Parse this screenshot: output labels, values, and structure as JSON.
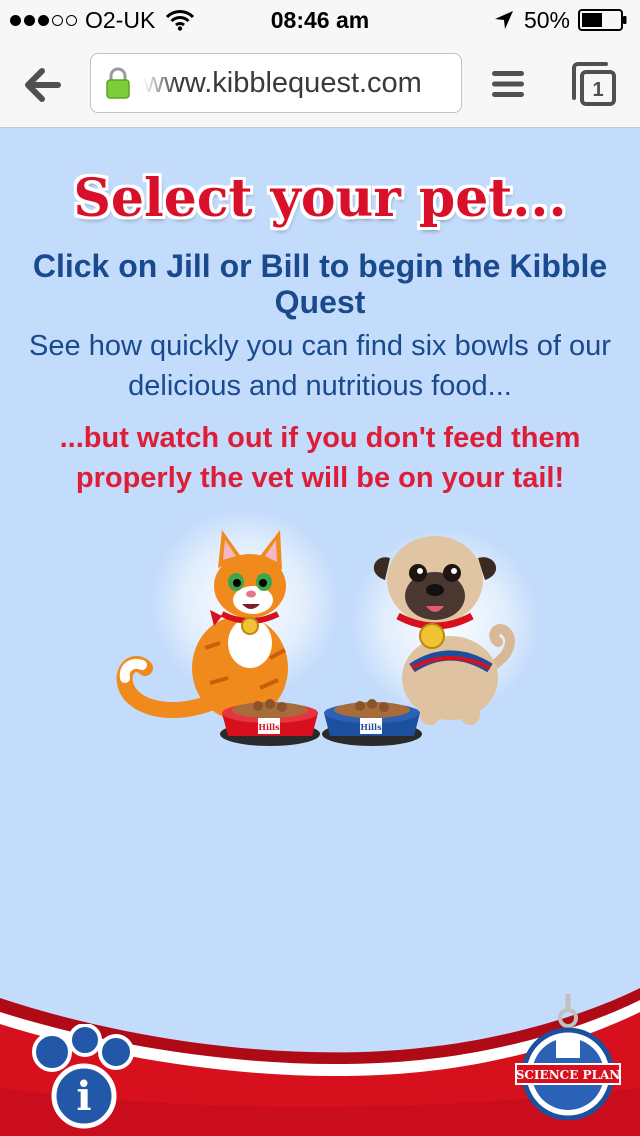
{
  "status_bar": {
    "carrier": "O2-UK",
    "time": "08:46 am",
    "battery": "50%",
    "signal_bars_filled": 3,
    "signal_bars_total": 5,
    "icons": [
      "wifi-icon",
      "location-arrow-icon",
      "battery-icon"
    ]
  },
  "browser": {
    "url": "www.kibblequest.com",
    "tab_count": "1",
    "icons": [
      "back-arrow-icon",
      "lock-icon",
      "menu-icon",
      "tabs-icon"
    ]
  },
  "page": {
    "headline": "Select your pet...",
    "sub_heading": "Click on Jill or Bill to begin the Kibble Quest",
    "description": "See how quickly you can find six bowls of our delicious and nutritious food...",
    "warning": "...but watch out if you don't feed them properly the vet will be on your tail!",
    "pets": [
      {
        "name": "Jill",
        "kind": "cat",
        "bowl_color": "#d8101e"
      },
      {
        "name": "Bill",
        "kind": "pug",
        "bowl_color": "#1c4f9e"
      }
    ],
    "bowl_label": "Hills",
    "logo_text": "SCIENCE PLAN",
    "info_label": "i"
  },
  "colors": {
    "background": "#c4dcfb",
    "headline_red": "#d8102a",
    "text_blue": "#1a4a8e",
    "warning_red": "#de1e38",
    "wave_red": "#d7101e"
  }
}
